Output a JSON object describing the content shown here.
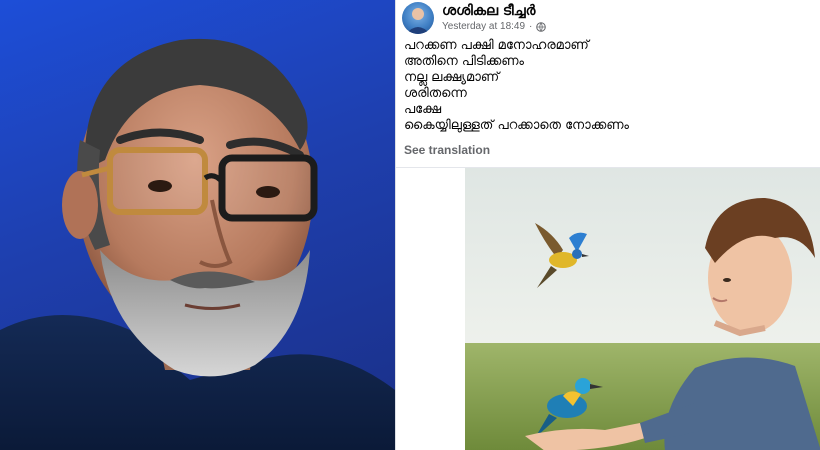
{
  "post": {
    "author": "ശശികല ടീച്ചർ",
    "timestamp": "Yesterday at 18:49",
    "separator": "·",
    "privacy_icon": "globe-icon",
    "lines": [
      "പറക്കണ പക്ഷി മനോഹരമാണ്",
      "അതിനെ പിടിക്കണം",
      "നല്ല ലക്ഷ്യമാണ്",
      "ശരിതന്നെ",
      "പക്ഷേ",
      "കൈയ്യിലുള്ളത് പറക്കാതെ നോക്കണം"
    ],
    "see_translation": "See translation"
  },
  "colors": {
    "left_background": "#1e3fae",
    "text_primary": "#050505",
    "text_secondary": "#65676b"
  }
}
